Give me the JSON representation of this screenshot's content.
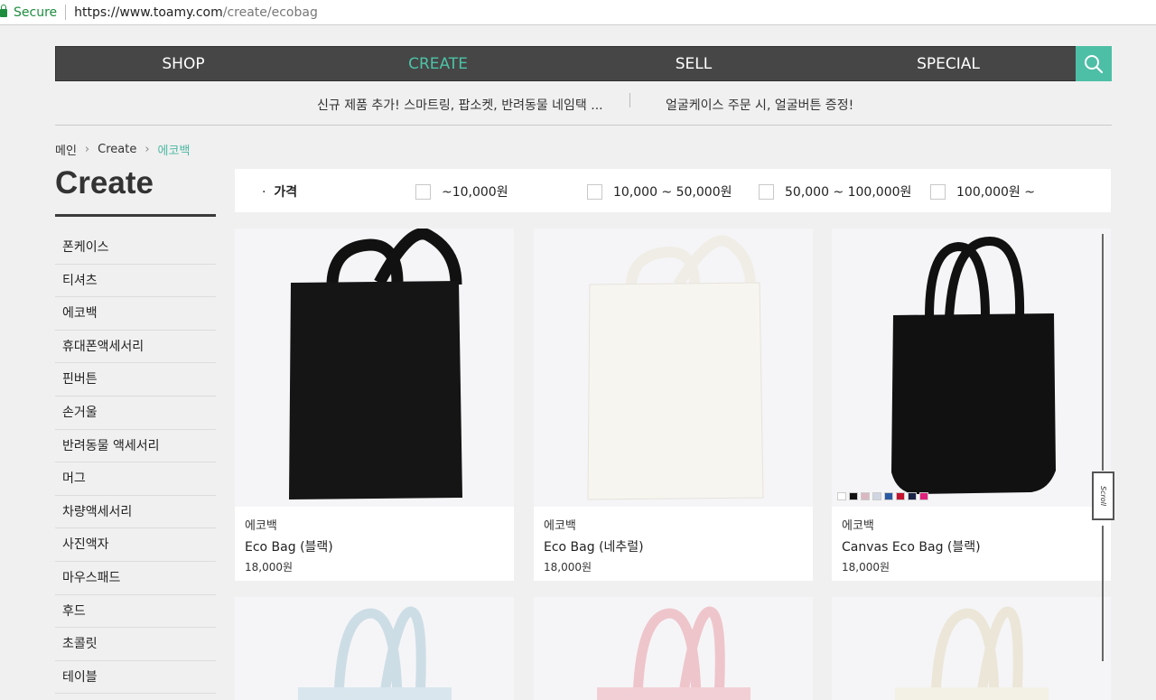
{
  "browser": {
    "secure_label": "Secure",
    "url_host": "https://www.toamy.com",
    "url_path": "/create/ecobag"
  },
  "nav": {
    "items": [
      "SHOP",
      "CREATE",
      "SELL",
      "SPECIAL"
    ],
    "active": "CREATE",
    "accent_color": "#4cc3a7"
  },
  "notices": [
    "신규 제품 추가! 스마트링, 팝소켓, 반려동물 네임택 ...",
    "얼굴케이스 주문 시, 얼굴버튼 증정!"
  ],
  "breadcrumb": {
    "items": [
      "메인",
      "Create",
      "에코백"
    ]
  },
  "sidebar": {
    "title": "Create",
    "items": [
      "폰케이스",
      "티셔츠",
      "에코백",
      "휴대폰액세서리",
      "핀버튼",
      "손거울",
      "반려동물 액세서리",
      "머그",
      "차량액세서리",
      "사진액자",
      "마우스패드",
      "후드",
      "초콜릿",
      "테이블"
    ]
  },
  "filter": {
    "label": "가격",
    "options": [
      "~10,000원",
      "10,000 ~ 50,000원",
      "50,000 ~ 100,000원",
      "100,000원 ~"
    ]
  },
  "products": [
    {
      "category": "에코백",
      "name": "Eco Bag (블랙)",
      "price": "18,000원",
      "bag_color": "#151515",
      "strap_color": "#111111"
    },
    {
      "category": "에코백",
      "name": "Eco Bag (네추럴)",
      "price": "18,000원",
      "bag_color": "#f7f5f0",
      "strap_color": "#f0ede6"
    },
    {
      "category": "에코백",
      "name": "Canvas Eco Bag (블랙)",
      "price": "18,000원",
      "bag_color": "#111111",
      "strap_color": "#111111",
      "swatch_colors": [
        "#ffffff",
        "#111111",
        "#d9b8c2",
        "#cfd6e2",
        "#2c5aa0",
        "#c4122f",
        "#1c2447",
        "#e0207c"
      ]
    },
    {
      "bag_color": "#d9e6ee",
      "strap_color": "#cddde6"
    },
    {
      "bag_color": "#f2cfd4",
      "strap_color": "#eec5cb"
    },
    {
      "bag_color": "#f3f0e6",
      "strap_color": "#ebe6d8"
    }
  ],
  "scroll_widget_label": "Scroll"
}
